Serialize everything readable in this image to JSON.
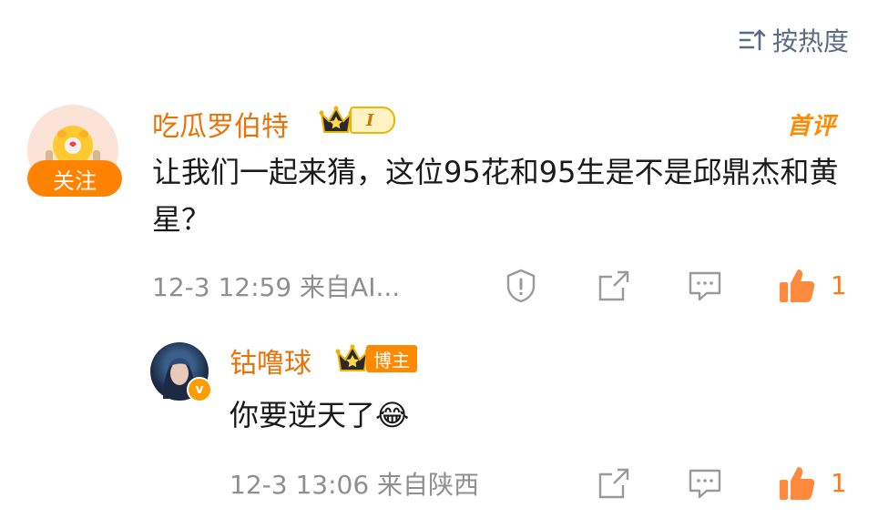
{
  "header": {
    "sort_label": "按热度",
    "sort_icon": "sort-icon"
  },
  "comment": {
    "author": "吃瓜罗伯特",
    "level_badge": "I",
    "follow_label": "关注",
    "first_tag": "首评",
    "text": "让我们一起来猜，这位95花和95生是不是邱鼎杰和黄星？",
    "time": "12-3 12:59",
    "source": "来自AI...",
    "like_count": "1",
    "accent_color": "#ff8200"
  },
  "reply": {
    "author": "钴噜球",
    "blogger_tag": "博主",
    "verified_mark": "v",
    "text": "你要逆天了😂",
    "time": "12-3 13:06",
    "source": "来自陕西",
    "like_count": "1"
  }
}
